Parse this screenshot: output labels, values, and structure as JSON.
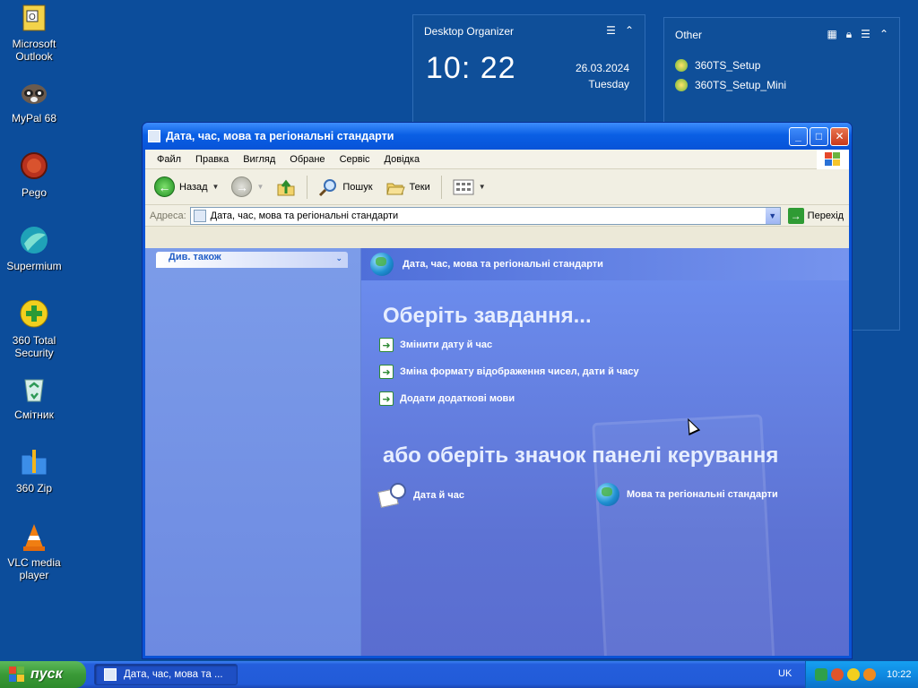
{
  "desktop": {
    "icons": [
      {
        "label": "Microsoft Outlook",
        "icon": "outlook-icon"
      },
      {
        "label": "MyPal 68",
        "icon": "mypal-icon"
      },
      {
        "label": "Pego",
        "icon": "pego-icon"
      },
      {
        "label": "Supermium",
        "icon": "supermium-icon"
      },
      {
        "label": "360 Total Security",
        "icon": "shield-plus-icon"
      },
      {
        "label": "Смітник",
        "icon": "recycle-bin-icon"
      },
      {
        "label": "360 Zip",
        "icon": "zip-folder-icon"
      },
      {
        "label": "VLC media player",
        "icon": "vlc-cone-icon"
      }
    ]
  },
  "widget_organizer": {
    "title": "Desktop Organizer",
    "time": "10: 22",
    "date": "26.03.2024",
    "weekday": "Tuesday"
  },
  "widget_other": {
    "title": "Other",
    "items": [
      "360TS_Setup",
      "360TS_Setup_Mini"
    ]
  },
  "window": {
    "title": "Дата, час, мова та регіональні стандарти",
    "menu": [
      "Файл",
      "Правка",
      "Вигляд",
      "Обране",
      "Сервіс",
      "Довідка"
    ],
    "toolbar": {
      "back": "Назад",
      "search": "Пошук",
      "folders": "Теки"
    },
    "address": {
      "label": "Адреса:",
      "value": "Дата, час, мова та регіональні стандарти",
      "go": "Перехід"
    },
    "left_pane": {
      "see_also": "Див. також"
    },
    "header": "Дата, час, мова та регіональні стандарти",
    "pick_task": "Оберіть завдання...",
    "tasks": [
      "Змінити дату й час",
      "Зміна формату відображення чисел, дати й часу",
      "Додати додаткові мови"
    ],
    "pick_icon": "або оберіть значок панелі керування",
    "icons": [
      "Дата й час",
      "Мова та регіональні стандарти"
    ]
  },
  "taskbar": {
    "start": "пуск",
    "task_button": "Дата, час, мова та ...",
    "language": "UK",
    "clock": "10:22"
  },
  "colors": {
    "desktop": "#0c4d9b",
    "window_frame": "#0a53d6",
    "start_button": "#3a9a37",
    "taskbar": "#225bd8"
  }
}
